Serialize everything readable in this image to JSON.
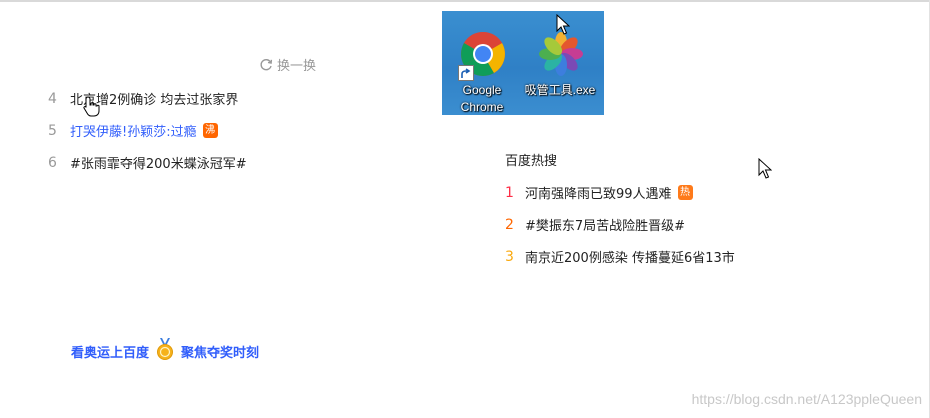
{
  "left_panel": {
    "refresh_label": "换一换",
    "items": [
      {
        "rank": "4",
        "text": "北京增2例确诊 均去过张家界",
        "badge": ""
      },
      {
        "rank": "5",
        "text": "打哭伊藤!孙颖莎:过瘾",
        "badge": "沸"
      },
      {
        "rank": "6",
        "text": "#张雨霏夺得200米蝶泳冠军#",
        "badge": ""
      }
    ]
  },
  "desktop": {
    "icons": [
      {
        "label_line1": "Google",
        "label_line2": "Chrome"
      },
      {
        "label_line1": "吸管工具.exe",
        "label_line2": ""
      }
    ]
  },
  "right_panel": {
    "title": "百度热搜",
    "items": [
      {
        "rank": "1",
        "text": "河南强降雨已致99人遇难",
        "badge": "热"
      },
      {
        "rank": "2",
        "text": "#樊振东7局苦战险胜晋级#",
        "badge": ""
      },
      {
        "rank": "3",
        "text": "南京近200例感染 传播蔓延6省13市",
        "badge": ""
      }
    ]
  },
  "promo": {
    "left_text": "看奥运上百度",
    "right_text": "聚焦夺奖时刻"
  },
  "watermark": "https://blog.csdn.net/A123ppleQueen",
  "colors": {
    "link": "#315efb",
    "badge_boil": "#f60",
    "badge_hot": "#fe7a1a",
    "rank1": "#fe2d46",
    "rank2": "#f60",
    "rank3": "#faa90e",
    "rank_gray": "#999999"
  }
}
